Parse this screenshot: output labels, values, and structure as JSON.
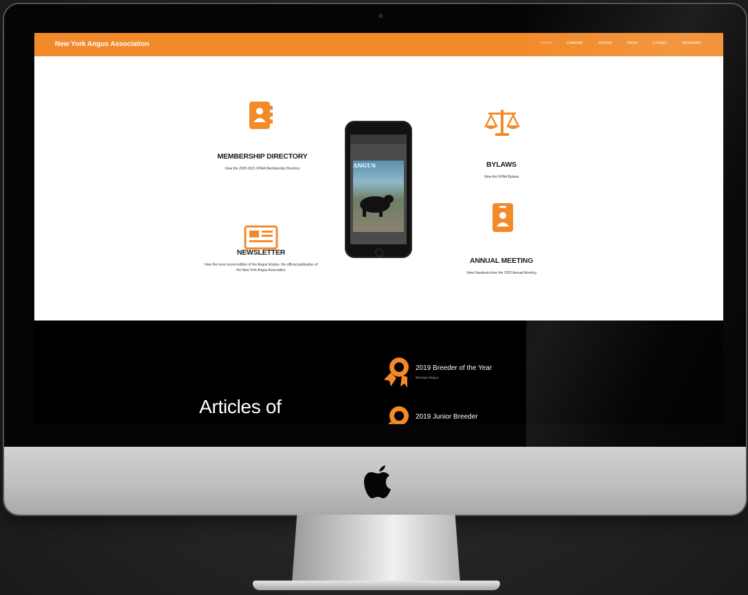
{
  "site": {
    "brand": "New York Angus Association",
    "nav": [
      "Home",
      "Calendar",
      "Archive",
      "News",
      "Contact",
      "Newsletter"
    ]
  },
  "features": {
    "membership": {
      "title": "MEMBERSHIP DIRECTORY",
      "desc": "View the 2020-2021 NYAA Membership Directory"
    },
    "newsletter": {
      "title": "NEWSLETTER",
      "desc": "View the most recent edition of the Angus Empire, the official publication of the New York Angus Association"
    },
    "bylaws": {
      "title": "BYLAWS",
      "desc": "View the NYAA Bylaws"
    },
    "annual_meeting": {
      "title": "ANNUAL MEETING",
      "desc": "View Handouts from the 2020 Annual Meeting"
    }
  },
  "phone": {
    "logo_text": "ANGUS"
  },
  "articles": {
    "heading": "Articles of",
    "awards": [
      {
        "title": "2019 Breeder of the Year",
        "subtitle": "Merriam Angus"
      },
      {
        "title": "2019 Junior Breeder",
        "subtitle": ""
      }
    ]
  },
  "colors": {
    "accent": "#f28a2a",
    "dark": "#000000"
  }
}
